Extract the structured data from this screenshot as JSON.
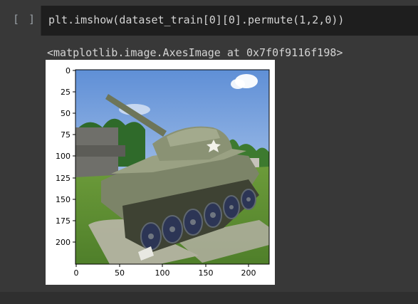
{
  "cell": {
    "run_indicator": "[ ]",
    "code": "plt.imshow(dataset_train[0][0].permute(1,2,0))"
  },
  "output": {
    "repr": "<matplotlib.image.AxesImage at 0x7f0f9116f198>",
    "figure": {
      "y_ticks": [
        "0",
        "25",
        "50",
        "75",
        "100",
        "125",
        "150",
        "175",
        "200"
      ],
      "x_ticks": [
        "0",
        "50",
        "100",
        "150",
        "200"
      ],
      "image_content": "tank-photo"
    }
  },
  "colors": {
    "background": "#383838",
    "code_bg": "#1e1e1e",
    "text": "#d4d4d4",
    "muted": "#9aa0a6"
  }
}
